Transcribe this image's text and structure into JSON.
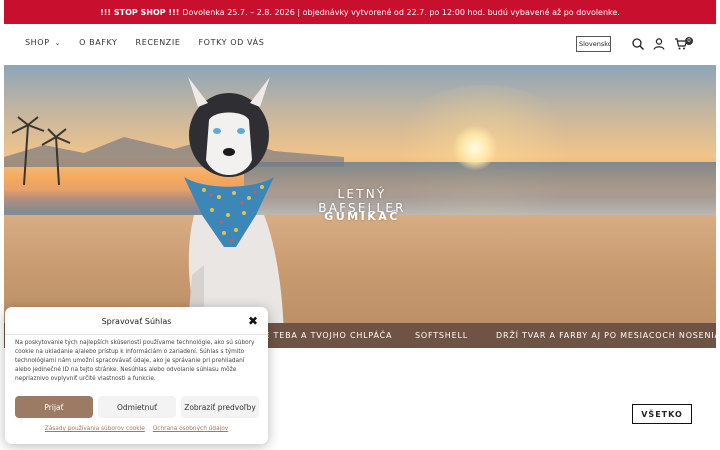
{
  "announcement": {
    "bold": "!!! STOP SHOP !!!",
    "text": "Dovolenka 25.7. – 2.8. 2026 | objednávky vytvorené od 22.7. po 12:00 hod. budú vybavené až po dovolenke."
  },
  "nav": {
    "items": [
      "SHOP",
      "O BAFKY",
      "RECENZIE",
      "FOTKY OD VÁS"
    ],
    "language": "Slovensko",
    "cart_count": "0"
  },
  "hero": {
    "title": "LETNÝ BAFSELLER",
    "subtitle": "GUMIKAČ"
  },
  "band": {
    "items": [
      "RE TEBA A TVOJHO CHLPÁČA",
      "SOFTSHELL",
      "DRŽÍ TVAR A FARBY AJ PO MESIACOCH NOSENIA"
    ]
  },
  "all_button": "VŠETKO",
  "cookie": {
    "title": "Spravovať Súhlas",
    "text": "Na poskytovanie tých najlepších skúseností používame technológie, ako sú súbory cookie na ukladanie a/alebo prístup k informáciám o zariadení. Súhlas s týmito technológiami nám umožní spracovávať údaje, ako je správanie pri prehliadaní alebo jedinečné ID na tejto stránke. Nesúhlas alebo odvolanie súhlasu môže nepriaznivo ovplyvniť určité vlastnosti a funkcie.",
    "accept": "Prijať",
    "deny": "Odmietnuť",
    "prefs": "Zobraziť predvoľby",
    "link_cookies": "Zásady používania súborov cookie",
    "link_privacy": "Ochrana osobných údajov"
  },
  "colors": {
    "announcement_bg": "#c8102e",
    "band_bg": "#6f5446",
    "accent": "#9c7a64"
  }
}
